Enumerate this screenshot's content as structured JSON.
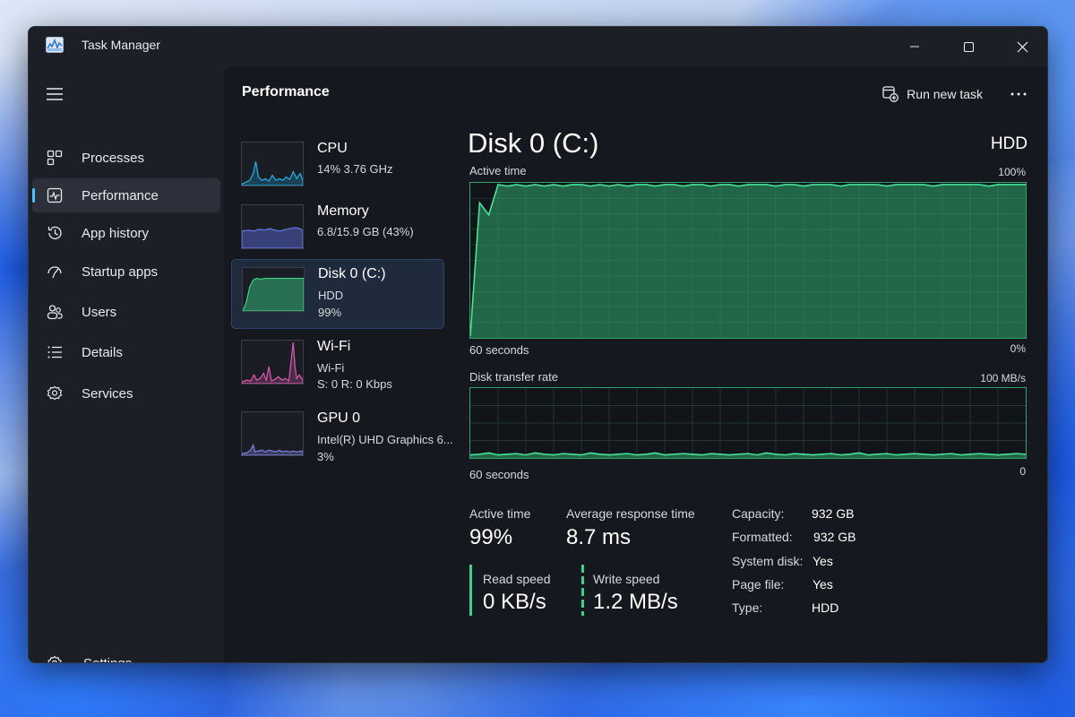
{
  "window": {
    "title": "Task Manager"
  },
  "sidebar": {
    "items": [
      {
        "label": "Processes",
        "icon": "processes-icon"
      },
      {
        "label": "Performance",
        "icon": "performance-icon",
        "active": true
      },
      {
        "label": "App history",
        "icon": "app-history-icon"
      },
      {
        "label": "Startup apps",
        "icon": "startup-apps-icon"
      },
      {
        "label": "Users",
        "icon": "users-icon"
      },
      {
        "label": "Details",
        "icon": "details-icon"
      },
      {
        "label": "Services",
        "icon": "services-icon"
      }
    ],
    "settings_label": "Settings"
  },
  "header": {
    "title": "Performance",
    "run_task_label": "Run new task"
  },
  "devices": [
    {
      "name": "CPU",
      "line1": "14%  3.76 GHz",
      "line2": "",
      "color": "#1fb4e8"
    },
    {
      "name": "Memory",
      "line1": "6.8/15.9 GB (43%)",
      "line2": "",
      "color": "#5b6fe0"
    },
    {
      "name": "Disk 0 (C:)",
      "line1": "HDD",
      "line2": "99%",
      "color": "#3ad28a",
      "active": true
    },
    {
      "name": "Wi-Fi",
      "line1": "Wi-Fi",
      "line2": "S: 0  R: 0 Kbps",
      "color": "#e05bb4"
    },
    {
      "name": "GPU 0",
      "line1": "Intel(R) UHD Graphics 6...",
      "line2": "3%",
      "color": "#7d86e8"
    }
  ],
  "detail": {
    "title": "Disk 0 (C:)",
    "type": "HDD",
    "active_graph": {
      "label": "Active time",
      "max": "100%",
      "span": "60 seconds",
      "min": "0%",
      "values_percent": [
        0,
        88,
        80,
        100,
        99,
        100,
        99,
        100,
        99,
        100,
        99,
        100,
        100,
        99,
        100,
        99,
        100,
        99,
        100,
        100,
        99,
        100,
        100,
        99,
        100,
        100,
        99,
        100,
        100,
        99,
        100,
        100,
        100,
        99,
        100,
        100,
        99,
        100,
        100,
        100,
        99,
        100,
        100,
        100,
        100,
        99,
        100,
        100,
        100,
        100,
        99,
        100,
        100,
        100,
        100,
        100,
        99,
        100,
        100,
        100,
        100
      ]
    },
    "transfer_graph": {
      "label": "Disk transfer rate",
      "max": "100 MB/s",
      "span": "60 seconds",
      "min": "0",
      "values_mbps": [
        2,
        3,
        5,
        2,
        3,
        4,
        2,
        5,
        3,
        2,
        4,
        3,
        2,
        5,
        3,
        2,
        3,
        4,
        2,
        3,
        5,
        2,
        3,
        4,
        3,
        2,
        4,
        3,
        2,
        3,
        4,
        2,
        5,
        3,
        2,
        4,
        3,
        2,
        3,
        4,
        2,
        3,
        5,
        2,
        3,
        4,
        2,
        3,
        4,
        3,
        2,
        3,
        4,
        2,
        3,
        4,
        3,
        2,
        3,
        4,
        3
      ]
    },
    "stats": {
      "active_time_label": "Active time",
      "active_time_value": "99%",
      "avg_response_label": "Average response time",
      "avg_response_value": "8.7 ms",
      "read_label": "Read speed",
      "read_value": "0 KB/s",
      "write_label": "Write speed",
      "write_value": "1.2 MB/s"
    },
    "props": [
      {
        "key": "Capacity:",
        "value": "932 GB"
      },
      {
        "key": "Formatted:",
        "value": "932 GB"
      },
      {
        "key": "System disk:",
        "value": "Yes"
      },
      {
        "key": "Page file:",
        "value": "Yes"
      },
      {
        "key": "Type:",
        "value": "HDD"
      }
    ]
  }
}
